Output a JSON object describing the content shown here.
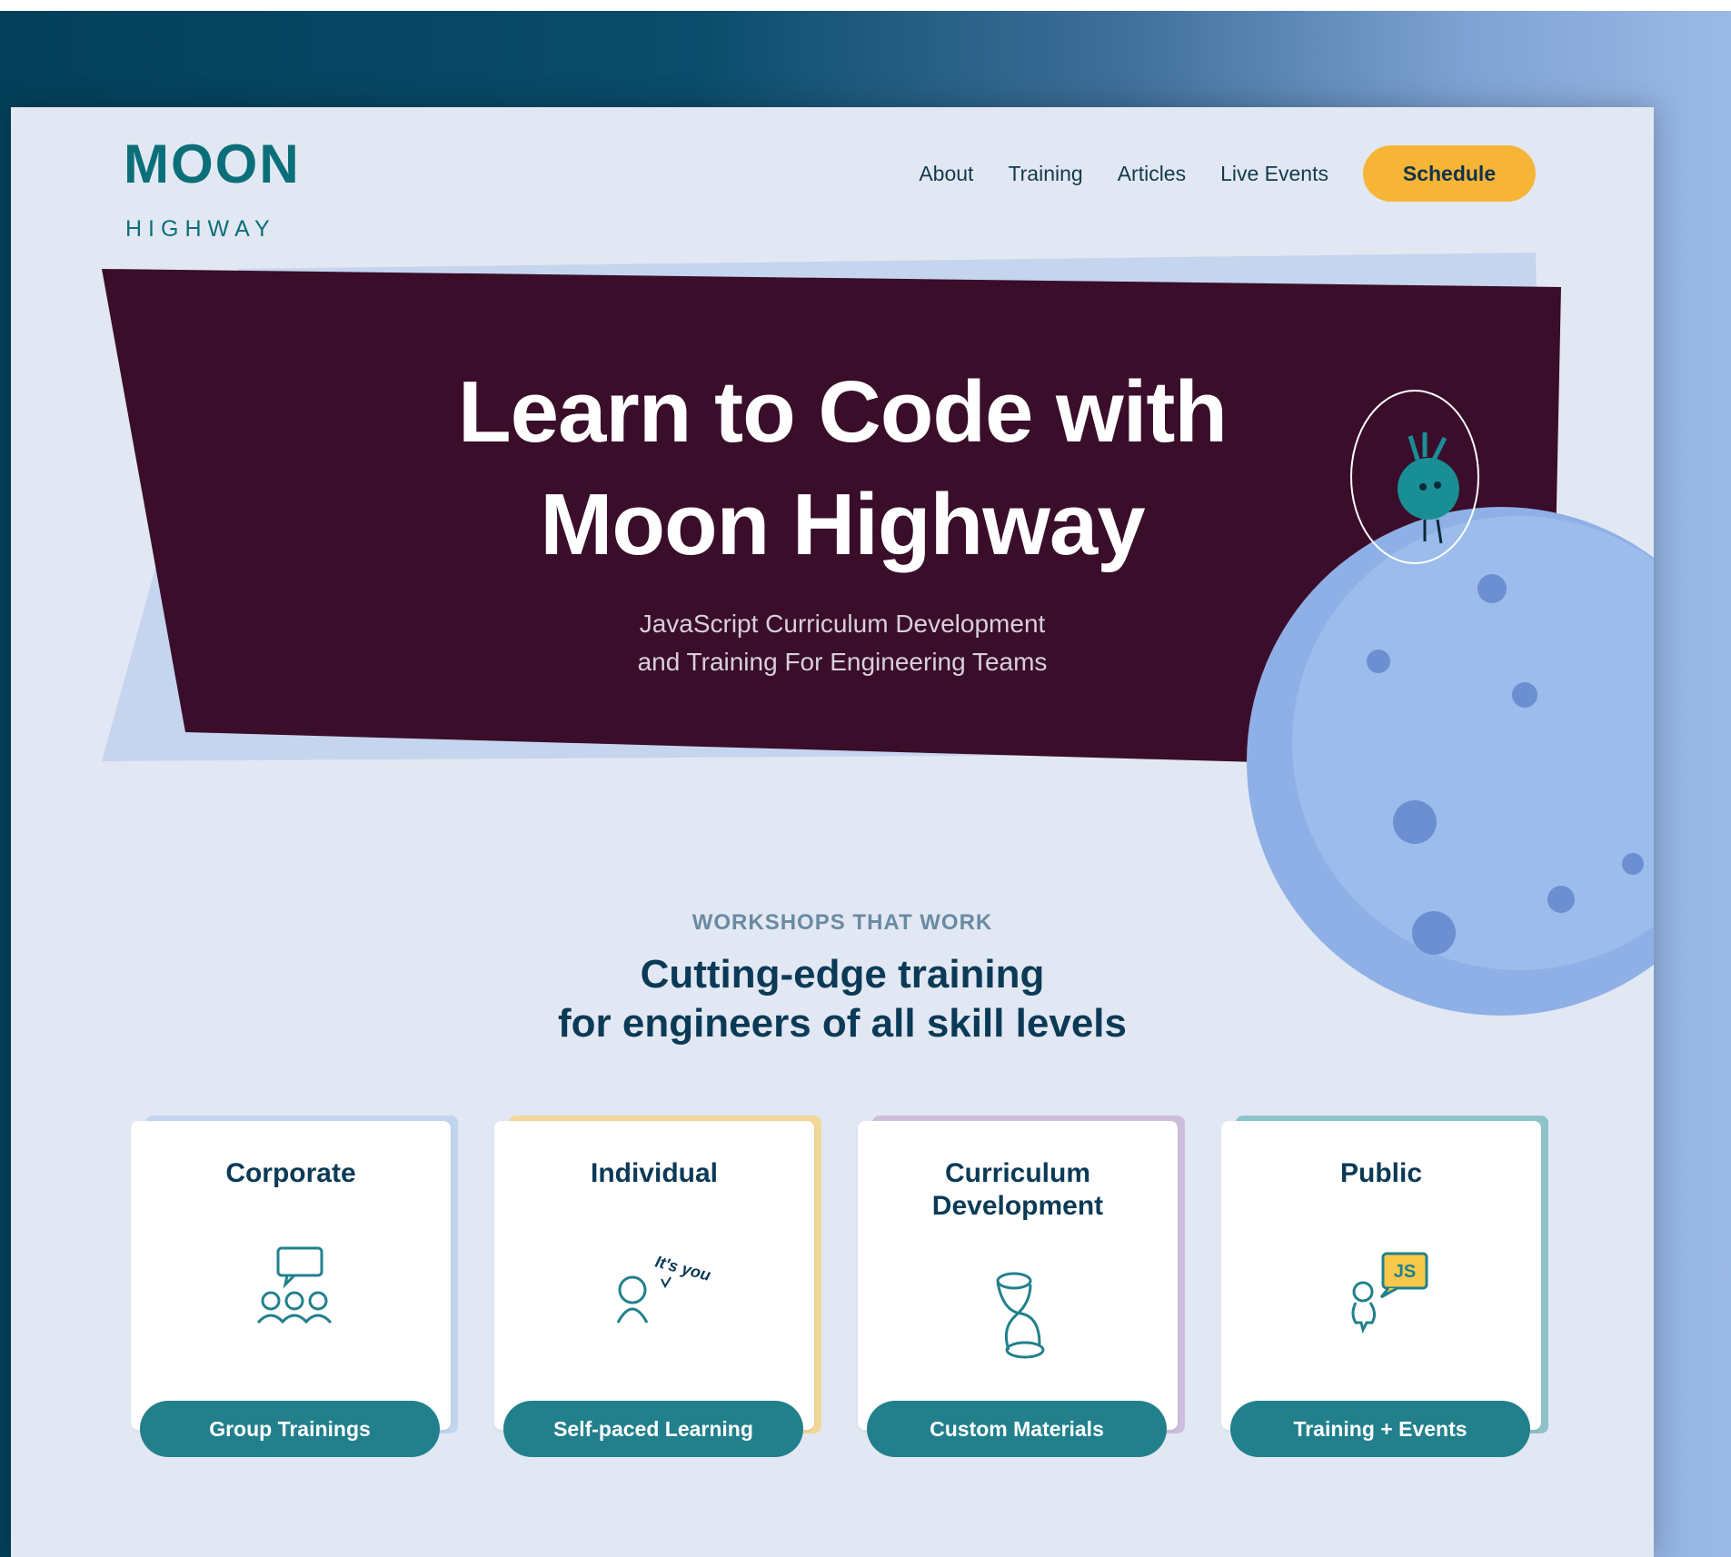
{
  "brand": {
    "logo_word": "MOON",
    "logo_sub": "HIGHWAY"
  },
  "nav": {
    "items": [
      "About",
      "Training",
      "Articles",
      "Live Events"
    ],
    "cta": "Schedule"
  },
  "hero": {
    "title_line1": "Learn to Code with",
    "title_line2": "Moon Highway",
    "subtitle_line1": "JavaScript Curriculum Development",
    "subtitle_line2": "and Training For Engineering Teams"
  },
  "section": {
    "eyebrow": "WORKSHOPS THAT WORK",
    "title_line1": "Cutting-edge training",
    "title_line2": "for engineers of all skill levels"
  },
  "cards": [
    {
      "title": "Corporate",
      "button": "Group Trainings",
      "icon": "group-chat-icon",
      "accent": "#c3d4ee"
    },
    {
      "title": "Individual",
      "button": "Self-paced Learning",
      "icon": "person-its-you-icon",
      "icon_text": "It's you",
      "accent": "#f1d79a"
    },
    {
      "title": "Curriculum\nDevelopment",
      "title_line1": "Curriculum",
      "title_line2": "Development",
      "button": "Custom Materials",
      "icon": "hourglass-icon",
      "accent": "#cdbfdb"
    },
    {
      "title": "Public",
      "button": "Training + Events",
      "icon": "person-js-icon",
      "icon_text": "JS",
      "accent": "#8fc3c9"
    }
  ],
  "colors": {
    "hero_bg": "#3a0d2a",
    "accent_yellow": "#f7b538",
    "teal": "#22808c",
    "navy": "#0b3a56",
    "moon": "#8fb0e6"
  }
}
